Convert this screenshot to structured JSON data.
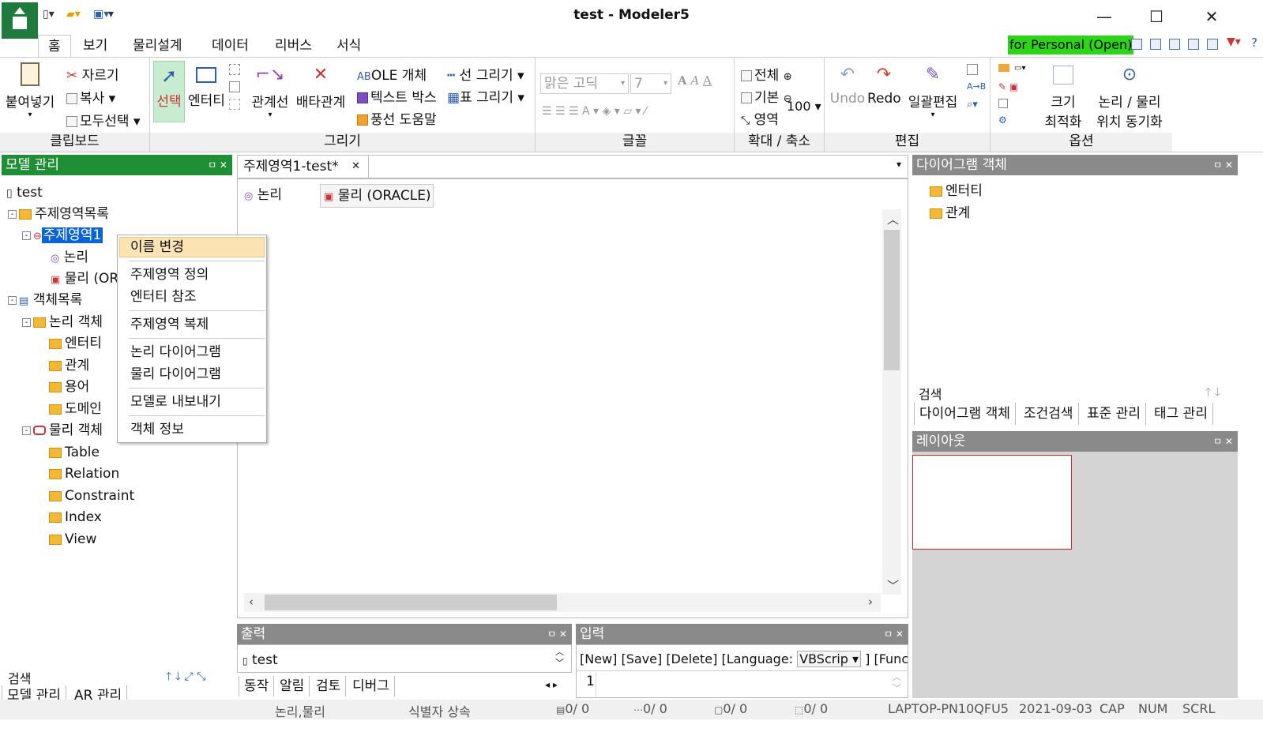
{
  "window": {
    "title": "test - Modeler5",
    "minimize": "—",
    "maximize": "☐",
    "close": "✕"
  },
  "menu": {
    "tabs": [
      "홈",
      "보기",
      "물리설계",
      "데이터",
      "리버스",
      "서식"
    ],
    "license": "for Personal (Open)",
    "help": "?"
  },
  "ribbon": {
    "clipboard": {
      "paste": "붙여넣기",
      "cut": "자르기",
      "copy": "복사",
      "selectall": "모두선택",
      "label": "클립보드"
    },
    "draw": {
      "select": "선택",
      "entity": "엔터티",
      "relline": "관계선",
      "exclusive": "배타관계",
      "ole": "OLE 개체",
      "textbox": "텍스트 박스",
      "balloon": "풍선 도움말",
      "line": "선 그리기",
      "table": "표 그리기",
      "label": "그리기"
    },
    "font": {
      "face": "맑은 고딕",
      "size": "7",
      "label": "글꼴"
    },
    "zoom": {
      "all": "전체",
      "basic": "기본",
      "area": "영역",
      "value": "100",
      "label": "확대 / 축소"
    },
    "edit": {
      "undo": "Undo",
      "redo": "Redo",
      "bulk": "일괄편집",
      "label": "편집"
    },
    "option": {
      "size": "크기",
      "size2": "최적화",
      "pos": "논리 / 물리",
      "pos2": "위치 동기화",
      "label": "옵션"
    }
  },
  "model_panel": {
    "title": "모델 관리",
    "tree": {
      "root": "test",
      "subject_list": "주제영역목록",
      "subject": "주제영역1",
      "logical": "논리",
      "physical": "물리 (ORACLE)",
      "object_list": "객체목록",
      "logical_objects": "논리 객체",
      "entity": "엔터티",
      "relation": "관계",
      "term": "용어",
      "domain": "도메인",
      "physical_objects": "물리 객체",
      "phys_items": [
        "Table",
        "Relation",
        "Constraint",
        "Index",
        "View"
      ]
    },
    "search_label": "검색",
    "tabs": [
      "모델 관리",
      "AR 관리"
    ]
  },
  "context_menu": {
    "items": [
      "이름 변경",
      "주제영역 정의",
      "엔터티 참조",
      "주제영역 복제",
      "논리 다이어그램",
      "물리 다이어그램",
      "모델로 내보내기",
      "객체 정보"
    ]
  },
  "document": {
    "tab": "주제영역1-test*",
    "subtabs": [
      "논리",
      "물리 (ORACLE)"
    ]
  },
  "diagram_panel": {
    "title": "다이어그램 객체",
    "items": [
      "엔터티",
      "관계"
    ],
    "search_label": "검색",
    "tabs": [
      "다이어그램 객체",
      "조건검색",
      "표준 관리",
      "태그 관리"
    ]
  },
  "layout_panel": {
    "title": "레이아웃"
  },
  "output_panel": {
    "title": "출력",
    "line": "test",
    "tabs": [
      "동작",
      "알림",
      "검토",
      "디버그"
    ]
  },
  "input_panel": {
    "title": "입력",
    "toolbar": "[New]  [Save]  [Delete]    [Language:",
    "language": "VBScrip",
    "funct": "]  [Funct",
    "line_no": "1"
  },
  "status": {
    "mode": "논리,물리",
    "inherit": "식별자 상속",
    "c1": "0/   0",
    "c2": "0/   0",
    "c3": "0/   0",
    "c4": "0/   0",
    "host": "LAPTOP-PN10QFU5",
    "date": "2021-09-03",
    "cap": "CAP",
    "num": "NUM",
    "scrl": "SCRL"
  },
  "colors": {
    "accent": "#1f7a3d",
    "panel_header_active": "#1f8f36",
    "panel_header": "#8a8a8a",
    "license_bg": "#2bd617",
    "selection": "#0a64d8"
  }
}
